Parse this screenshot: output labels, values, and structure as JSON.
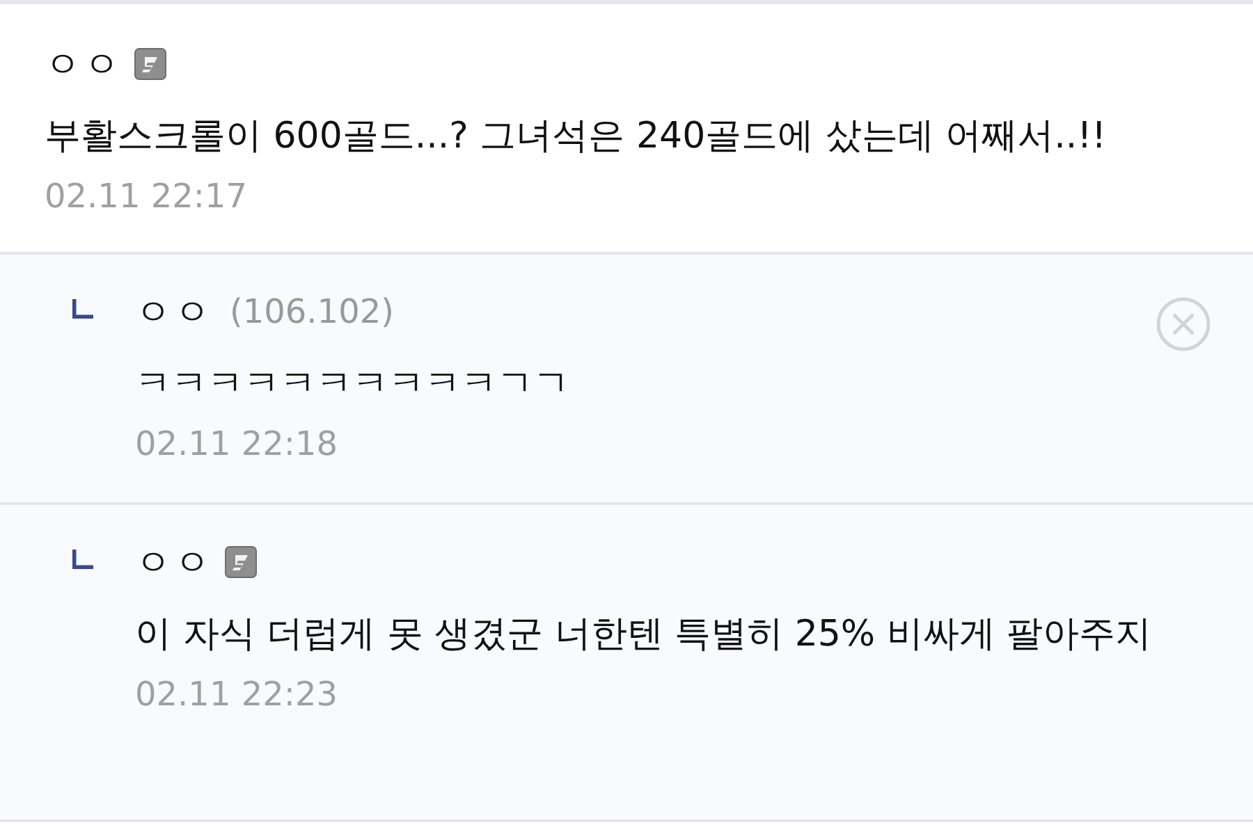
{
  "comments": [
    {
      "kind": "comment",
      "author": "ㅇㅇ",
      "member_badge": true,
      "text": "부활스크롤이 600골드...? 그녀석은 240골드에 샀는데 어째서..!!",
      "time": "02.11 22:17",
      "deletable": false
    },
    {
      "kind": "reply",
      "author": "ㅇㅇ",
      "ip": "(106.102)",
      "member_badge": false,
      "text": "ㅋㅋㅋㅋㅋㅋㅋㅋㅋㅋㄱㄱ",
      "time": "02.11 22:18",
      "deletable": true
    },
    {
      "kind": "reply",
      "author": "ㅇㅇ",
      "member_badge": true,
      "text": "이 자식 더럽게 못 생겼군 너한텐 특별히 25% 비싸게 팔아주지",
      "time": "02.11 22:23",
      "deletable": false
    }
  ]
}
